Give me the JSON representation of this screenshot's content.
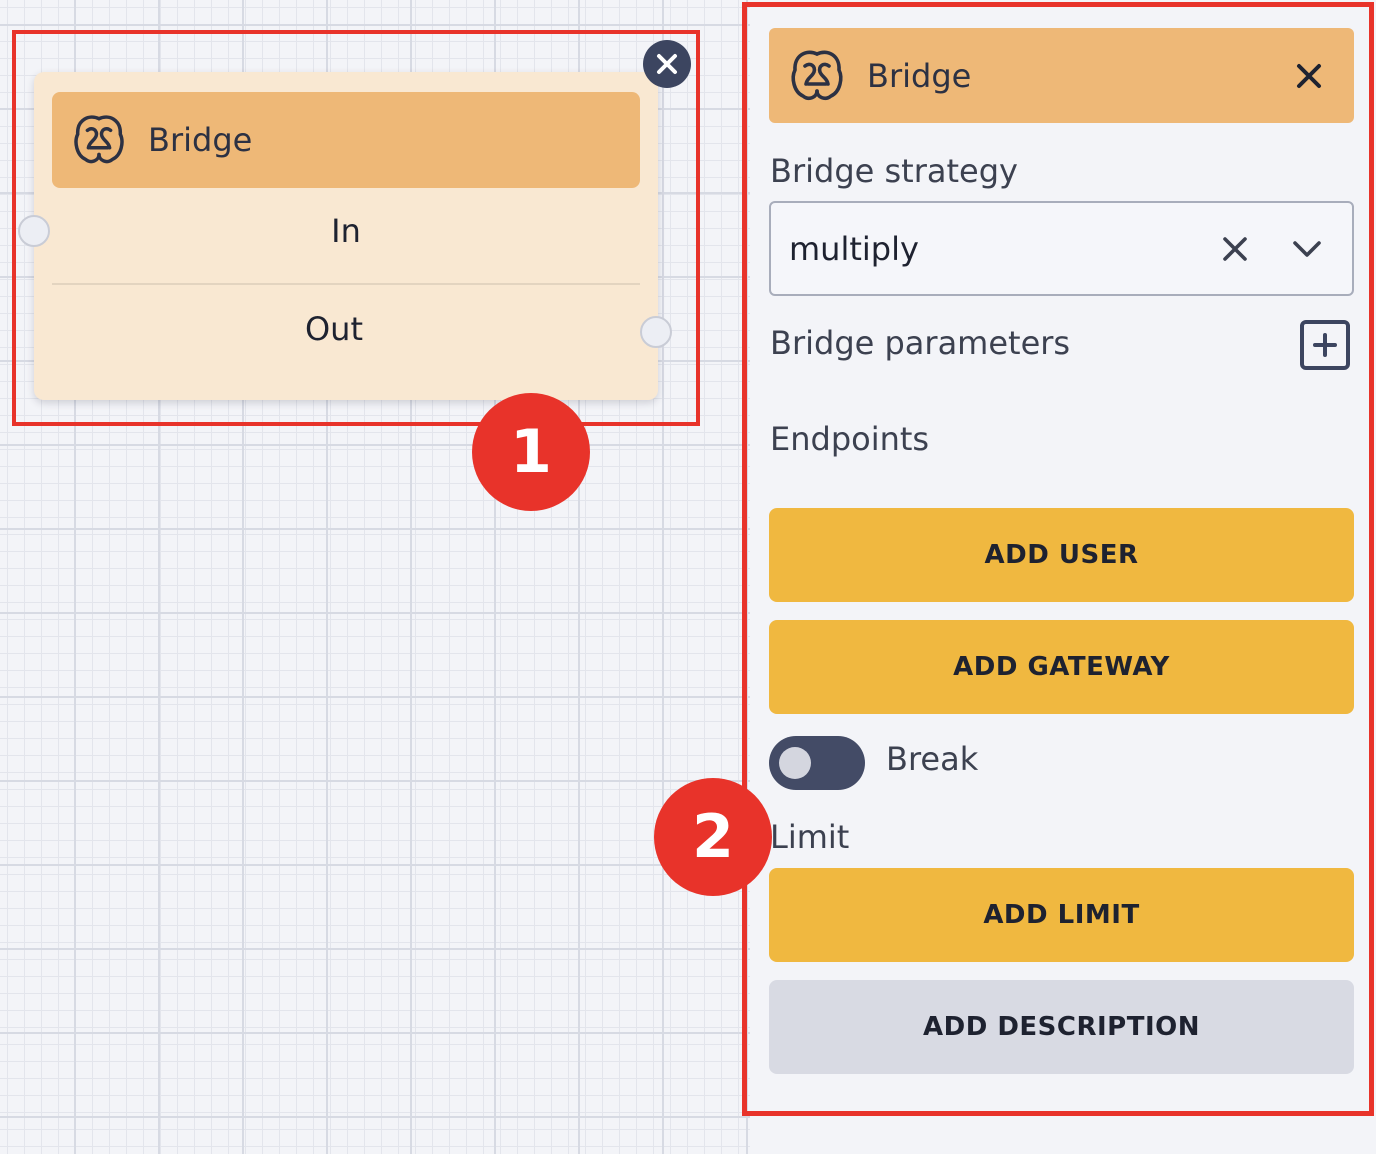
{
  "node": {
    "title": "Bridge",
    "ports": {
      "in": "In",
      "out": "Out"
    },
    "icon": "bridge-icon",
    "close_icon": "close-circle-icon"
  },
  "badges": {
    "first": "1",
    "second": "2"
  },
  "panel": {
    "title": "Bridge",
    "icon": "bridge-icon",
    "close_icon": "close-icon",
    "strategy": {
      "label": "Bridge strategy",
      "value": "multiply",
      "clear_icon": "clear-icon",
      "dropdown_icon": "chevron-down-icon"
    },
    "parameters": {
      "label": "Bridge parameters",
      "add_icon": "plus-square-icon"
    },
    "endpoints": {
      "label": "Endpoints",
      "add_user": "ADD USER",
      "add_gateway": "ADD GATEWAY"
    },
    "break": {
      "label": "Break",
      "enabled": false
    },
    "limit": {
      "label": "Limit",
      "add_limit": "ADD LIMIT"
    },
    "add_description": "ADD DESCRIPTION"
  },
  "colors": {
    "header": "#eeb877",
    "node_body": "#f9e8d2",
    "primary_button": "#f0b840",
    "secondary_button": "#d8dae3",
    "highlight": "#e8332a",
    "dark": "#3c4560"
  }
}
